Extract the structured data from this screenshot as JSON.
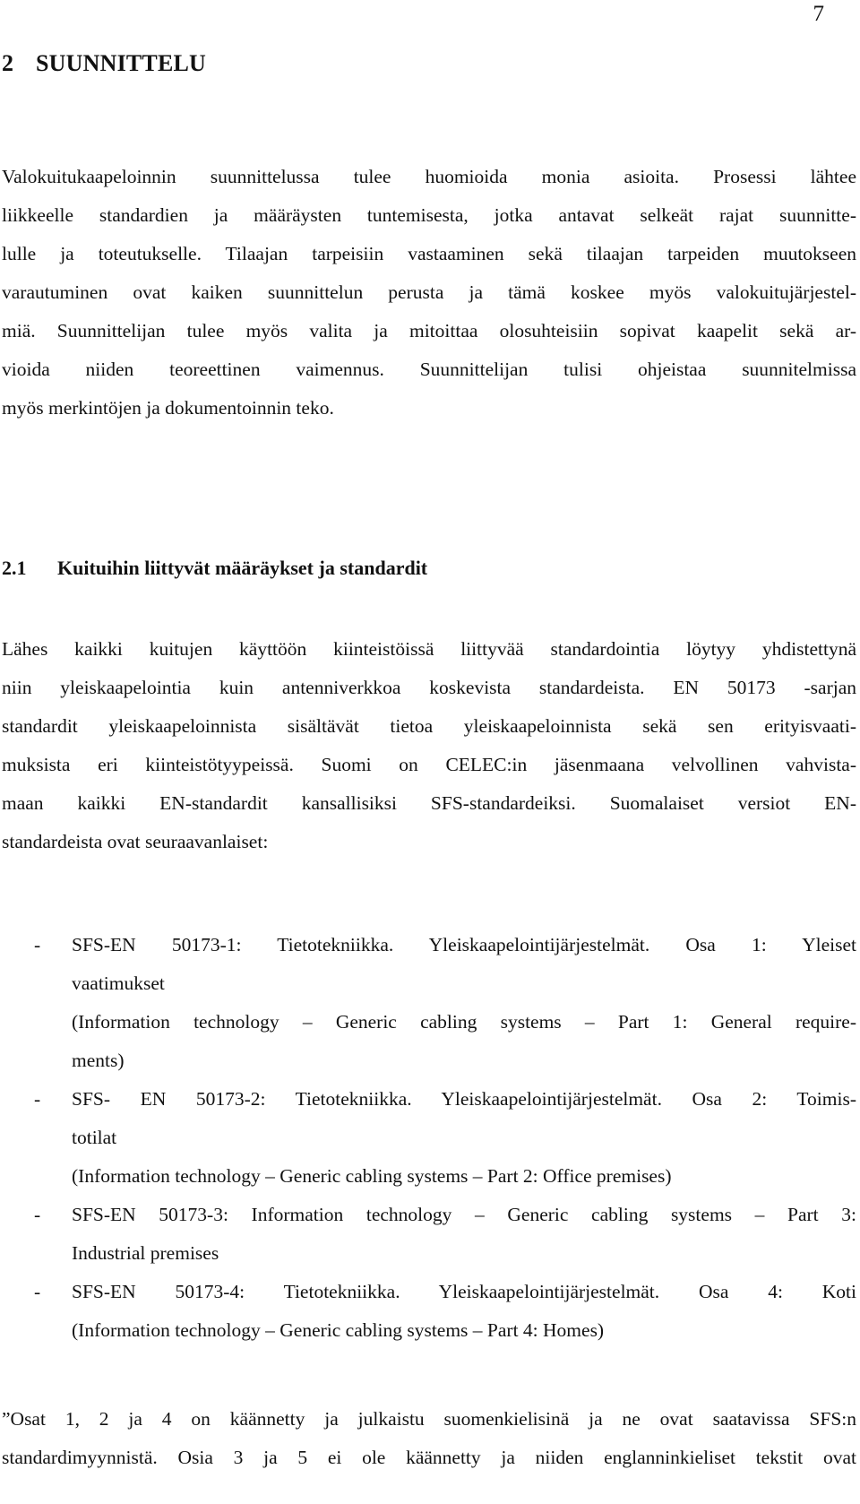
{
  "page_number": "7",
  "chapter": {
    "number": "2",
    "title": "SUUNNITTELU"
  },
  "intro_paragraph": [
    "Valokuitukaapeloinnin suunnittelussa tulee huomioida monia asioita. Prosessi lähtee",
    "liikkeelle standardien ja määräysten tuntemisesta, jotka antavat selkeät rajat suunnitte-",
    "lulle ja toteutukselle. Tilaajan tarpeisiin vastaaminen sekä tilaajan tarpeiden muutokseen",
    "varautuminen ovat kaiken suunnittelun perusta ja tämä koskee myös valokuitujärjestel-",
    "miä. Suunnittelijan tulee myös valita ja mitoittaa olosuhteisiin sopivat kaapelit sekä ar-",
    "vioida niiden teoreettinen vaimennus. Suunnittelijan tulisi ohjeistaa suunnitelmissa",
    "myös merkintöjen ja dokumentoinnin teko."
  ],
  "section": {
    "number": "2.1",
    "title": "Kuituihin liittyvät määräykset ja standardit"
  },
  "section_paragraph": [
    "Lähes kaikki kuitujen käyttöön kiinteistöissä liittyvää standardointia löytyy yhdistettynä",
    "niin yleiskaapelointia kuin antenniverkkoa koskevista standardeista. EN 50173 -sarjan",
    "standardit yleiskaapeloinnista sisältävät tietoa yleiskaapeloinnista sekä sen erityisvaati-",
    "muksista eri kiinteistötyypeissä. Suomi on CELEC:in jäsenmaana velvollinen vahvista-",
    "maan kaikki EN-standardit kansallisiksi SFS-standardeiksi. Suomalaiset versiot EN-",
    "standardeista ovat seuraavanlaiset:"
  ],
  "standards_list": [
    {
      "bullet": "-",
      "lines": [
        "SFS-EN 50173-1: Tietotekniikka. Yleiskaapelointijärjestelmät. Osa 1: Yleiset",
        "vaatimukset",
        "(Information technology – Generic cabling systems – Part 1: General require-",
        "ments)"
      ]
    },
    {
      "bullet": "-",
      "lines": [
        "SFS- EN 50173-2: Tietotekniikka. Yleiskaapelointijärjestelmät. Osa 2: Toimis-",
        "totilat",
        "(Information technology – Generic cabling systems – Part 2: Office premises)"
      ]
    },
    {
      "bullet": "-",
      "lines": [
        "SFS-EN 50173-3: Information technology – Generic cabling systems – Part 3:",
        "Industrial premises"
      ]
    },
    {
      "bullet": "-",
      "lines": [
        "SFS-EN 50173-4: Tietotekniikka. Yleiskaapelointijärjestelmät. Osa 4: Koti",
        "(Information technology – Generic cabling systems – Part 4: Homes)"
      ]
    }
  ],
  "closing_paragraph": [
    "”Osat 1, 2 ja 4 on käännetty ja julkaistu suomenkielisinä ja ne ovat saatavissa SFS:n",
    "standardimyynnistä. Osia 3 ja 5 ei ole käännetty ja niiden englanninkieliset tekstit ovat"
  ]
}
